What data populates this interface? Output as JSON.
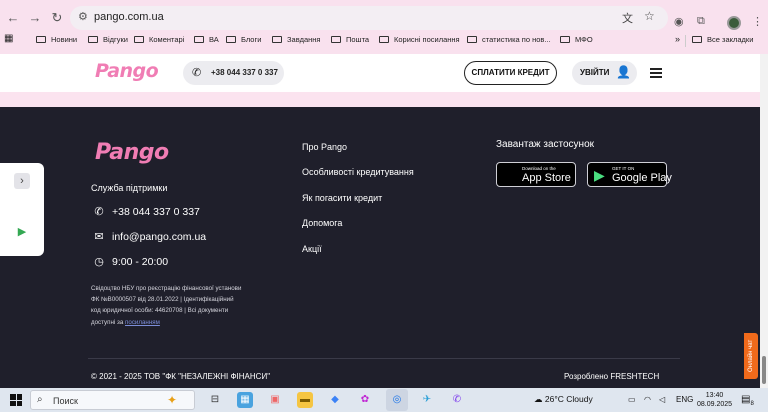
{
  "browser": {
    "url": "pango.com.ua",
    "bookmarks": [
      "Новини",
      "Відгуки",
      "Коментарі",
      "ВА",
      "Блоги",
      "Завдання",
      "Пошта",
      "Корисні посилання",
      "статистика по нов...",
      "МФО"
    ],
    "more_bookmarks": "»",
    "all_bookmarks": "Все закладки"
  },
  "header": {
    "logo": "Pango",
    "phone": "+38 044 337 0 337",
    "pay_button": "СПЛАТИТИ КРЕДИТ",
    "login_button": "УВІЙТИ"
  },
  "footer": {
    "logo": "Pango",
    "support_title": "Служба підтримки",
    "phone": "+38 044 337 0 337",
    "email": "info@pango.com.ua",
    "hours": "9:00 - 20:00",
    "license_text": "Свідоцтво НБУ про реєстрацію фінансової установи ФК №В0000507 від 28.01.2022 | Ідентифікаційний код юридичної особи: 44620708 | Всі документи доступні за",
    "license_link": "посиланням",
    "menu": [
      "Про Pango",
      "Особливості кредитування",
      "Як погасити кредит",
      "Допомога",
      "Акції"
    ],
    "app_title": "Завантаж застосунок",
    "app_store": {
      "small": "Download on the",
      "big": "App Store"
    },
    "google_play": {
      "small": "GET IT ON",
      "big": "Google Play"
    },
    "copyright": "© 2021 - 2025 ТОВ \"ФК \"НЕЗАЛЕЖНІ ФІНАНСИ\"",
    "developed_by": "Розроблено FRESHTECH"
  },
  "chat_tab": "Онлайн чат",
  "taskbar": {
    "search_placeholder": "Поиск",
    "weather": "26°C  Cloudy",
    "language": "ENG",
    "time": "13:40",
    "date": "08.09.2025",
    "notifications": "8"
  },
  "colors": {
    "brand_pink": "#f07db4",
    "footer_bg": "#1f1f2b",
    "chat_orange": "#f06a1b"
  }
}
